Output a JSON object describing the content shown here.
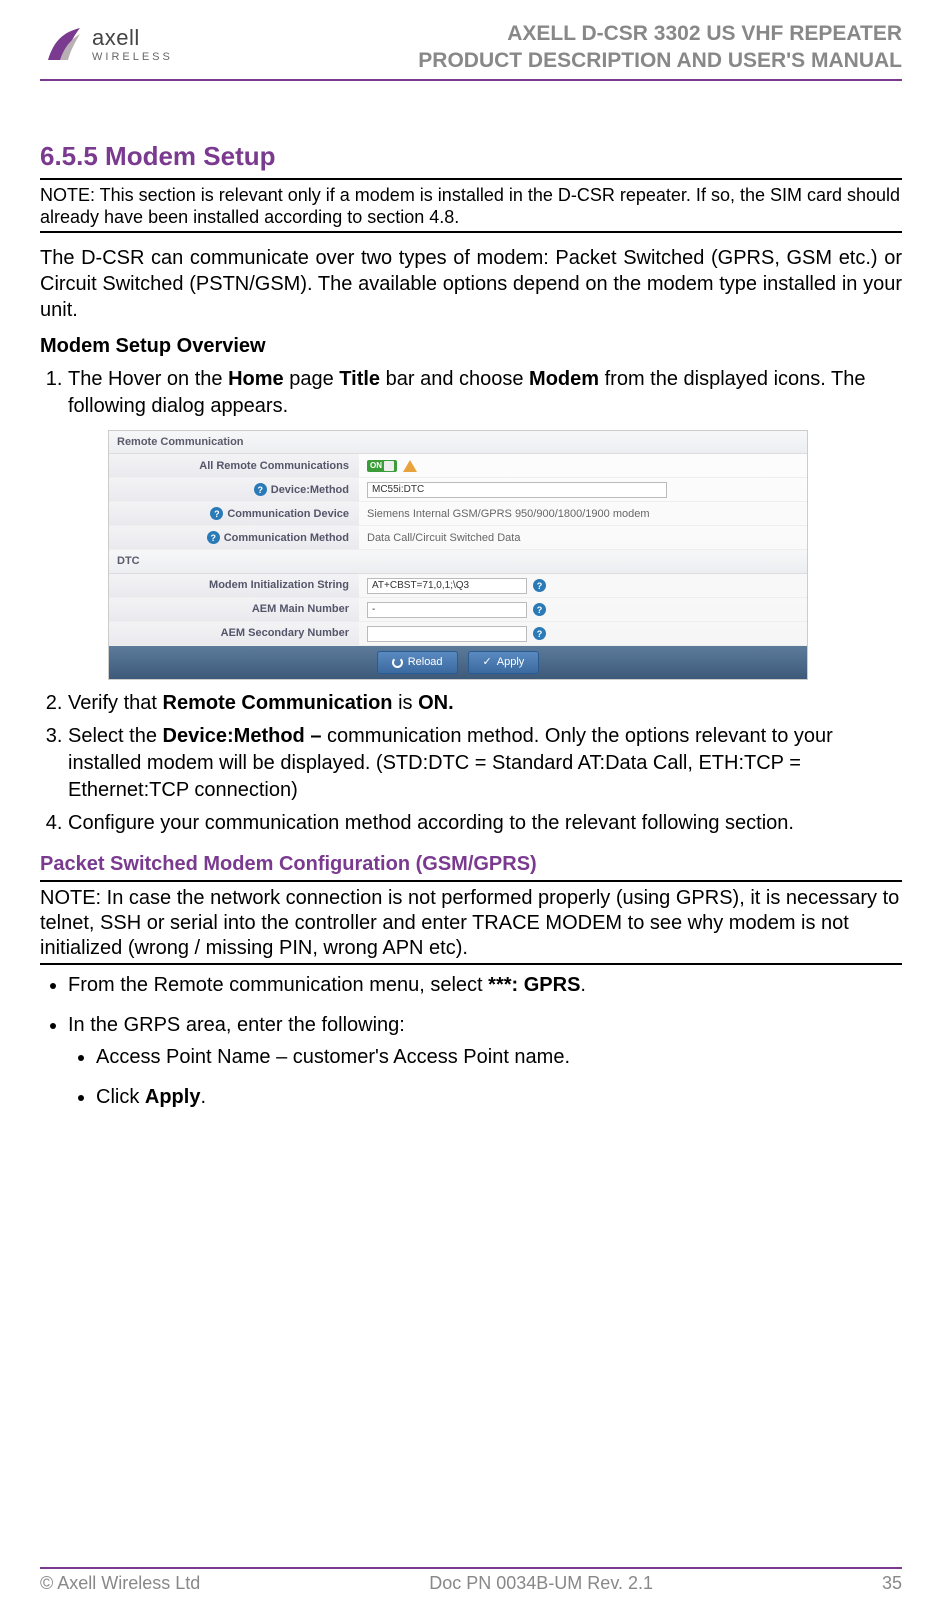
{
  "header": {
    "brand_top": "axell",
    "brand_bottom": "WIRELESS",
    "title_line1": "AXELL D-CSR 3302 US VHF REPEATER",
    "title_line2": "PRODUCT DESCRIPTION AND USER'S MANUAL"
  },
  "section": {
    "number_title": "6.5.5 Modem Setup",
    "note1": "NOTE: This section is relevant only if a modem is installed in the D-CSR repeater. If so, the SIM card should already have been installed according to section 4.8.",
    "intro": "The D-CSR can communicate over two types of modem: Packet Switched (GPRS, GSM etc.) or Circuit Switched (PSTN/GSM). The available options depend on the modem type installed in your unit.",
    "overview_heading": "Modem Setup Overview",
    "step1_a": "The Hover on the ",
    "step1_b": "Home",
    "step1_c": " page ",
    "step1_d": "Title",
    "step1_e": " bar and choose ",
    "step1_f": "Modem",
    "step1_g": " from the displayed icons. The following dialog appears.",
    "step2_a": "Verify that ",
    "step2_b": "Remote Communication",
    "step2_c": " is ",
    "step2_d": "ON.",
    "step3_a": "Select the ",
    "step3_b": "Device:Method – ",
    "step3_c": "communication method. Only the options relevant to your installed modem will be displayed. (STD:DTC = Standard AT:Data Call, ETH:TCP = Ethernet:TCP connection)",
    "step4": "Configure your communication method according to the relevant following section.",
    "packet_heading": "Packet Switched Modem Configuration (GSM/GPRS)",
    "note2": "NOTE: In case the network connection is not performed properly (using GPRS), it is necessary to telnet, SSH or serial into the controller and enter TRACE MODEM to see why modem is not initialized (wrong / missing PIN, wrong APN etc).",
    "bullet1_a": "From the Remote communication menu, select ",
    "bullet1_b": "***: GPRS",
    "bullet1_c": ".",
    "bullet2": "In the GRPS area, enter the following:",
    "bullet2a": " Access Point Name – customer's Access Point name.",
    "bullet2b_a": "Click ",
    "bullet2b_b": "Apply",
    "bullet2b_c": "."
  },
  "ui": {
    "section1_title": "Remote Communication",
    "row1_label": "All Remote Communications",
    "row1_toggle": "ON",
    "row2_label": "Device:Method",
    "row2_value": "MC55i:DTC",
    "row3_label": "Communication Device",
    "row3_value": "Siemens Internal GSM/GPRS 950/900/1800/1900 modem",
    "row4_label": "Communication Method",
    "row4_value": "Data Call/Circuit Switched Data",
    "section2_title": "DTC",
    "row5_label": "Modem Initialization String",
    "row5_value": "AT+CBST=71,0,1;\\Q3",
    "row6_label": "AEM Main Number",
    "row6_value": "-",
    "row7_label": "AEM Secondary Number",
    "row7_value": "",
    "btn_reload": "Reload",
    "btn_apply": "Apply"
  },
  "footer": {
    "left": "© Axell Wireless Ltd",
    "center": "Doc PN 0034B-UM Rev. 2.1",
    "right": "35"
  }
}
